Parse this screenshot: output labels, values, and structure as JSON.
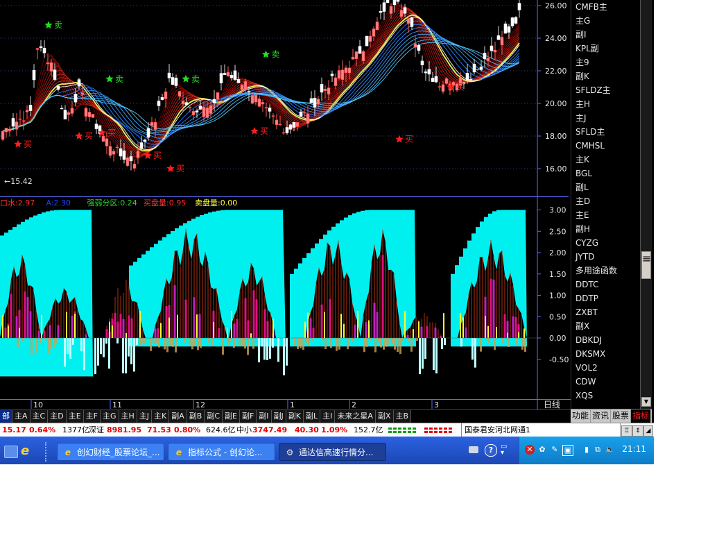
{
  "price_axis": {
    "labels": [
      "26.00",
      "24.00",
      "22.00",
      "20.00",
      "18.00",
      "16.00"
    ]
  },
  "price_low_label": "←15.42",
  "signals": {
    "sell_label": "卖",
    "buy_label": "买"
  },
  "indicator_header": [
    {
      "text": "口水:2.97",
      "color": "#ff3030"
    },
    {
      "text": "A:2.30",
      "color": "#2040ff"
    },
    {
      "text": "强弱分区:0.24",
      "color": "#30d030"
    },
    {
      "text": "买盘量:0.95",
      "color": "#ff3030"
    },
    {
      "text": "卖盘量:0.00",
      "color": "#ffff40"
    }
  ],
  "indicator_axis": {
    "labels": [
      "3.00",
      "2.50",
      "2.00",
      "1.50",
      "1.00",
      "0.50",
      "0.00",
      "-0.50"
    ]
  },
  "date_axis": {
    "labels": [
      "10",
      "11",
      "12",
      "1",
      "2",
      "3"
    ],
    "period": "日线"
  },
  "side_list": [
    "CMFB主",
    "主G",
    "副I",
    "KPL副",
    "主9",
    "副K",
    "SFLDZ主",
    "主H",
    "主J",
    "SFLD主",
    "CMHSL",
    "主K",
    "BGL",
    "副L",
    "主D",
    "主E",
    "副H",
    "CYZG",
    "JYTD",
    "多用途函数",
    "DDTC",
    "DDTP",
    "ZXBT",
    "副X",
    "DBKDJ",
    "DKSMX",
    "VOL2",
    "CDW",
    "XQS"
  ],
  "side_tabs": [
    "功能",
    "资讯",
    "股票",
    "指标"
  ],
  "bottom_tabs": [
    "部",
    "主A",
    "主C",
    "主D",
    "主E",
    "主F",
    "主G",
    "主H",
    "主J",
    "主K",
    "副A",
    "副B",
    "副C",
    "副E",
    "副F",
    "副I",
    "副J",
    "副K",
    "副L",
    "主I",
    "未来之星A",
    "副X",
    "主B"
  ],
  "status": {
    "v1": "15.17",
    "v2": "0.64%",
    "v3": "1377亿",
    "sz_label": "深证",
    "sz_val": "8981.95",
    "sz_chg": "71.53",
    "sz_pct": "0.80%",
    "sz_amt": "624.6亿",
    "zx_label": "中小",
    "zx_val": "3747.49",
    "zx_chg": "40.30",
    "zx_pct": "1.09%",
    "zx_amt": "152.7亿",
    "broker": "国泰君安河北网通1"
  },
  "taskbar": {
    "buttons": [
      "创幻财经_股票论坛_...",
      "指标公式 - 创幻论...",
      "通达信高速行情分..."
    ],
    "clock": "21:11"
  }
}
